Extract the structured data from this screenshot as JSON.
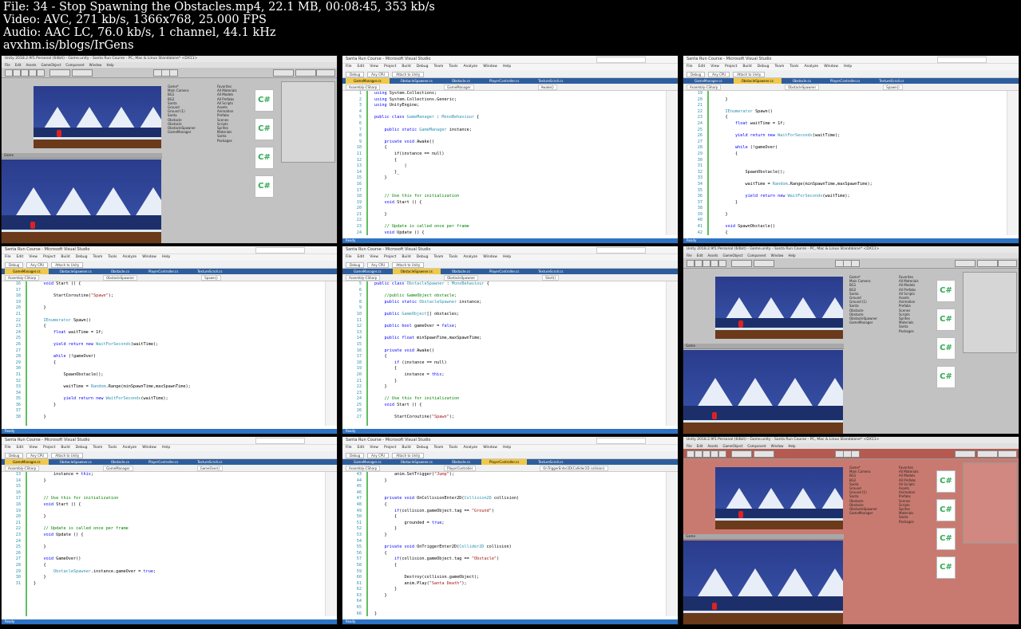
{
  "header": {
    "line1": "File: 34 - Stop Spawning the Obstacles.mp4, 22.1 MB, 00:08:45, 353 kb/s",
    "line2": "Video: AVC, 271 kb/s, 1366x768, 25.000 FPS",
    "line3": "Audio: AAC LC, 76.0 kb/s, 1 channel, 44.1 kHz",
    "line4": "avxhm.is/blogs/IrGens"
  },
  "thumbs": [
    {
      "type": "unity",
      "title": "Unity 2018.2.9f1 Personal (64bit) - Game.unity - Santa Run Course - PC, Mac & Linux Standalone* <DX11>",
      "red": false
    },
    {
      "type": "vs",
      "title": "Santa Run Course - Microsoft Visual Studio",
      "tabs": [
        "GameManager.cs",
        "ObstacleSpawner.cs",
        "Obstacle.cs",
        "PlayerController.cs",
        "TextureScroll.cs"
      ],
      "active": 0,
      "nav": [
        "Assembly-CSharp",
        "GameManager",
        "Awake()"
      ],
      "start": 1,
      "lines": [
        "<span class='kw'>using</span> System.Collections;",
        "<span class='kw'>using</span> System.Collections.Generic;",
        "<span class='kw'>using</span> UnityEngine;",
        "",
        "<span class='kw'>public class</span> <span class='ty'>GameManager</span> : <span class='ty'>MonoBehaviour</span> {",
        "",
        "    <span class='kw'>public static</span> <span class='ty'>GameManager</span> instance;",
        "",
        "    <span class='kw'>private void</span> Awake()",
        "    {",
        "        if(instance == null)",
        "        {",
        "            |",
        "        }_",
        "    }",
        "",
        "",
        "    <span class='cm'>// Use this for initialization</span>",
        "    <span class='kw'>void</span> Start () {",
        "",
        "    }",
        "",
        "    <span class='cm'>// Update is called once per frame</span>",
        "    <span class='kw'>void</span> Update () {"
      ]
    },
    {
      "type": "vs",
      "title": "Santa Run Course - Microsoft Visual Studio",
      "tabs": [
        "GameManager.cs",
        "ObstacleSpawner.cs",
        "Obstacle.cs",
        "PlayerController.cs",
        "TextureScroll.cs"
      ],
      "active": 1,
      "nav": [
        "Assembly-CSharp",
        "ObstacleSpawner",
        "Spawn()"
      ],
      "start": 19,
      "lines": [
        "",
        "    }",
        "",
        "    <span class='ty'>IEnumerator</span> Spawn()",
        "    {",
        "        <span class='kw'>float</span> waitTime = 1f;",
        "",
        "        <span class='kw'>yield return new</span> <span class='ty'>WaitForSeconds</span>(waitTime);",
        "",
        "        <span class='kw'>while</span> (!gameOver)",
        "        {",
        "",
        "",
        "            SpawnObstacle();",
        "",
        "            waitTime = <span class='ty'>Random</span>.Range(minSpawnTime,maxSpawnTime);",
        "",
        "            <span class='kw'>yield return new</span> <span class='ty'>WaitForSeconds</span>(waitTime);",
        "        }",
        "",
        "    }",
        "",
        "    <span class='kw'>void</span> SpawnObstacle()",
        "    {"
      ]
    },
    {
      "type": "vs",
      "title": "Santa Run Course - Microsoft Visual Studio",
      "tabs": [
        "GameManager.cs",
        "ObstacleSpawner.cs",
        "Obstacle.cs",
        "PlayerController.cs",
        "TextureScroll.cs"
      ],
      "active": 0,
      "nav": [
        "Assembly-CSharp",
        "ObstacleSpawner",
        "Spawn()"
      ],
      "start": 16,
      "lines": [
        "    <span class='kw'>void</span> Start () {",
        "",
        "        StartCoroutine(<span class='st'>\"Spawn\"</span>);",
        "",
        "    }",
        "",
        "    <span class='ty'>IEnumerator</span> Spawn()",
        "    {",
        "        <span class='kw'>float</span> waitTime = 1f;",
        "",
        "        <span class='kw'>yield return new</span> <span class='ty'>WaitForSeconds</span>(waitTime);",
        "",
        "        <span class='kw'>while</span> (!gameOver)",
        "        {",
        "",
        "            SpawnObstacle();",
        "",
        "            waitTime = <span class='ty'>Random</span>.Range(minSpawnTime,maxSpawnTime);",
        "",
        "            <span class='kw'>yield return new</span> <span class='ty'>WaitForSeconds</span>(waitTime);",
        "        }",
        "",
        "    }"
      ]
    },
    {
      "type": "vs",
      "title": "Santa Run Course - Microsoft Visual Studio",
      "tabs": [
        "GameManager.cs",
        "ObstacleSpawner.cs",
        "Obstacle.cs",
        "PlayerController.cs",
        "TextureScroll.cs"
      ],
      "active": 1,
      "nav": [
        "Assembly-CSharp",
        "ObstacleSpawner",
        "Start()"
      ],
      "start": 5,
      "lines": [
        "<span class='kw'>public class</span> <span class='ty'>ObstacleSpawner</span> : <span class='ty'>MonoBehaviour</span> {",
        "",
        "    <span class='cm'>//public GameObject obstacle;</span>",
        "    <span class='kw'>public static</span> <span class='ty'>ObstacleSpawner</span> instance;",
        "",
        "    <span class='kw'>public</span> <span class='ty'>GameObject</span>[] obstacles;",
        "",
        "    <span class='kw'>public bool</span> gameOver = <span class='kw'>false</span>;",
        "",
        "    <span class='kw'>public float</span> minSpawnTime,maxSpawnTime;",
        "",
        "    <span class='kw'>private void</span> Awake()",
        "    {",
        "        <span class='kw'>if</span> (instance == null)",
        "        {",
        "            instance = <span class='kw'>this</span>;",
        "        }",
        "    }",
        "",
        "    <span class='cm'>// Use this for initialization</span>",
        "    <span class='kw'>void</span> Start () {",
        "",
        "        StartCoroutine(<span class='st'>\"Spawn\"</span>);"
      ]
    },
    {
      "type": "unity",
      "title": "Unity 2018.2.9f1 Personal (64bit) - Game.unity - Santa Run Course - PC, Mac & Linux Standalone* <DX11>",
      "red": false
    },
    {
      "type": "vs",
      "title": "Santa Run Course - Microsoft Visual Studio",
      "tabs": [
        "GameManager.cs",
        "ObstacleSpawner.cs",
        "Obstacle.cs",
        "PlayerController.cs",
        "TextureScroll.cs"
      ],
      "active": 0,
      "nav": [
        "Assembly-CSharp",
        "GameManager",
        "GameOver()"
      ],
      "start": 13,
      "lines": [
        "        instance = <span class='kw'>this</span>;",
        "    }",
        "",
        "",
        "    <span class='cm'>// Use this for initialization</span>",
        "    <span class='kw'>void</span> Start () {",
        "",
        "    }",
        "",
        "    <span class='cm'>// Update is called once per frame</span>",
        "    <span class='kw'>void</span> Update () {",
        "",
        "    }",
        "",
        "    <span class='kw'>void</span> GameOver()",
        "    {",
        "        <span class='ty'>ObstacleSpawner</span>.instance.gameOver = <span class='kw'>true</span>;",
        "    }",
        "}"
      ]
    },
    {
      "type": "vs",
      "title": "Santa Run Course - Microsoft Visual Studio",
      "tabs": [
        "GameManager.cs",
        "ObstacleSpawner.cs",
        "Obstacle.cs",
        "PlayerController.cs",
        "TextureScroll.cs"
      ],
      "active": 3,
      "nav": [
        "Assembly-CSharp",
        "PlayerController",
        "OnTriggerEnter2D(Collider2D collision)"
      ],
      "start": 43,
      "lines": [
        "        anim.SetTrigger(<span class='st'>\"Jump\"</span>);",
        "    }",
        "",
        "",
        "    <span class='kw'>private void</span> OnCollisionEnter2D(<span class='ty'>Collision2D</span> collision)",
        "    {",
        "        <span class='kw'>if</span>(collision.gameObject.tag == <span class='st'>\"Ground\"</span>)",
        "        {",
        "            grounded = <span class='kw'>true</span>;",
        "        }",
        "    }",
        "",
        "    <span class='kw'>private void</span> OnTriggerEnter2D(<span class='ty'>Collider2D</span> collision)",
        "    {",
        "        <span class='kw'>if</span>(collision.gameObject.tag == <span class='st'>\"Obstacle\"</span>)",
        "        {",
        "",
        "            Destroy(collision.gameObject);",
        "            anim.Play(<span class='st'>\"Santa Death\"</span>);",
        "        }",
        "    }",
        "",
        "",
        "}"
      ]
    },
    {
      "type": "unity",
      "title": "Unity 2018.2.9f1 Personal (64bit) - Game.unity - Santa Run Course - PC, Mac & Linux Standalone* <DX11>",
      "red": true
    }
  ],
  "vs_menu": [
    "File",
    "Edit",
    "View",
    "Project",
    "Build",
    "Debug",
    "Team",
    "Tools",
    "Analyze",
    "Window",
    "Help"
  ],
  "vs_toolbar": [
    "Debug",
    "Any CPU",
    "Attach to Unity"
  ],
  "vs_status": "Ready",
  "unity_menu": [
    "File",
    "Edit",
    "Assets",
    "GameObject",
    "Component",
    "Window",
    "Help"
  ],
  "unity_hierarchy": [
    "Game*",
    "Main Camera",
    "BG1",
    "BG2",
    "Santa",
    "Ground",
    "Ground (1)",
    "Santa",
    "Obstacle",
    "Obstacle",
    "ObstacleSpawner",
    "GameManager"
  ],
  "unity_project": [
    "Favorites",
    "All Materials",
    "All Models",
    "All Prefabs",
    "All Scripts",
    "Assets",
    "Animation",
    "Prefabs",
    "Scenes",
    "Scripts",
    "Sprites",
    "Materials",
    "Santa",
    "Packages"
  ],
  "unity_scripts": [
    "C#",
    "C#",
    "C#",
    "C#"
  ],
  "colors": {
    "vs_blue": "#2d5d9c",
    "vs_status": "#2d73c5",
    "vs_active_tab": "#f0c84a",
    "unity_bg": "#c2c2c2",
    "unity_red_tint": "#c66a60",
    "scene_sky": "#2a3c8c"
  }
}
